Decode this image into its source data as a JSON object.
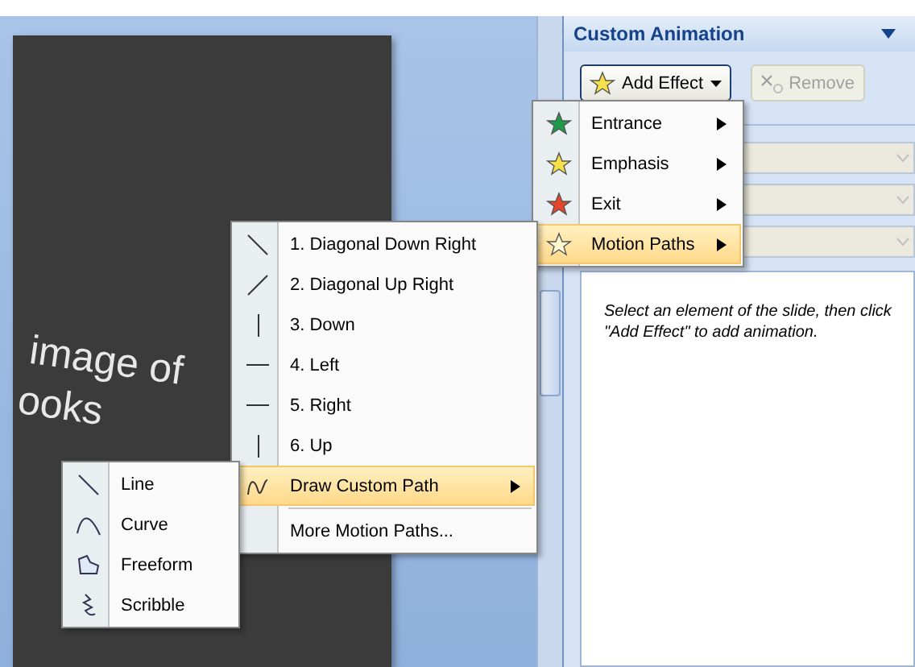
{
  "slide": {
    "texts": [
      "image of",
      "ooks"
    ]
  },
  "task_pane": {
    "title": "Custom Animation",
    "add_effect": {
      "label": "Add Effect"
    },
    "remove": {
      "label": "Remove",
      "disabled": true
    },
    "combos": [
      {
        "disabled": true
      },
      {
        "disabled": true
      },
      {
        "disabled": true
      }
    ],
    "hint": "Select an element of the slide, then click \"Add Effect\" to add animation."
  },
  "add_effect_menu": [
    {
      "label": "Entrance",
      "kind": "entrance",
      "submenu": true,
      "selected": false
    },
    {
      "label": "Emphasis",
      "kind": "emphasis",
      "submenu": true,
      "selected": false
    },
    {
      "label": "Exit",
      "kind": "exit",
      "submenu": true,
      "selected": false
    },
    {
      "label": "Motion Paths",
      "kind": "motion",
      "submenu": true,
      "selected": true
    }
  ],
  "motion_paths_menu": [
    {
      "label": "1. Diagonal Down Right",
      "kind": "diag-down",
      "submenu": false,
      "selected": false
    },
    {
      "label": "2. Diagonal Up Right",
      "kind": "diag-up",
      "submenu": false,
      "selected": false
    },
    {
      "label": "3. Down",
      "kind": "vertical",
      "submenu": false,
      "selected": false
    },
    {
      "label": "4. Left",
      "kind": "horizontal",
      "submenu": false,
      "selected": false
    },
    {
      "label": "5. Right",
      "kind": "horizontal",
      "submenu": false,
      "selected": false
    },
    {
      "label": "6. Up",
      "kind": "vertical",
      "submenu": false,
      "selected": false
    },
    {
      "label": "Draw Custom Path",
      "kind": "custom",
      "submenu": true,
      "selected": true
    },
    {
      "label": "More Motion Paths...",
      "kind": "none",
      "submenu": false,
      "selected": false
    }
  ],
  "custom_path_menu": [
    {
      "label": "Line",
      "kind": "line",
      "submenu": false,
      "selected": false
    },
    {
      "label": "Curve",
      "kind": "curve",
      "submenu": false,
      "selected": false
    },
    {
      "label": "Freeform",
      "kind": "freeform",
      "submenu": false,
      "selected": false
    },
    {
      "label": "Scribble",
      "kind": "scribble",
      "submenu": false,
      "selected": false
    }
  ]
}
